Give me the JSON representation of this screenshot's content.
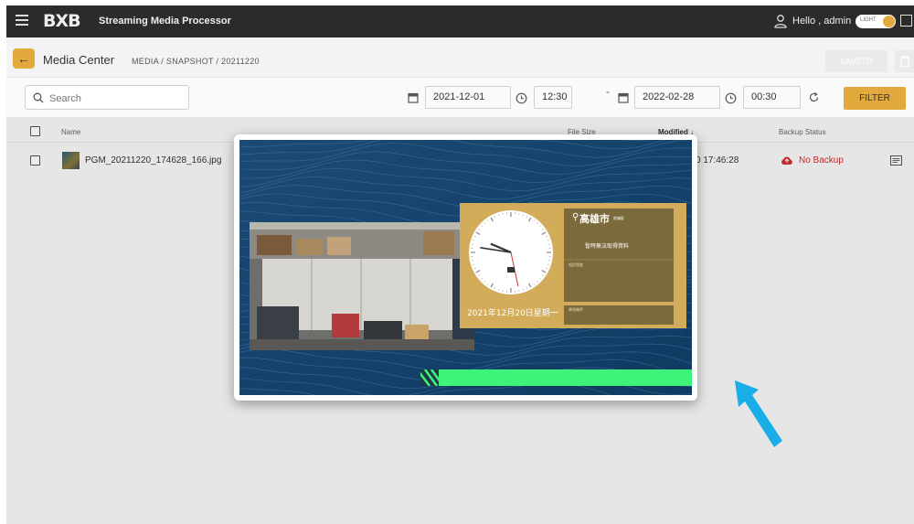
{
  "topbar": {
    "logo": "BXB",
    "app_title": "Streaming Media Processor",
    "greeting": "Hello , admin",
    "theme_toggle_label": "LIGHT"
  },
  "header": {
    "title": "Media Center",
    "breadcrumb": "MEDIA  /  SNAPSHOT  /  20211220",
    "saveto_label": "SAVETO"
  },
  "filters": {
    "search_placeholder": "Search",
    "start_date": "2021-12-01",
    "start_time": "12:30",
    "separator": "-",
    "end_date": "2022-02-28",
    "end_time": "00:30",
    "filter_label": "FILTER"
  },
  "table": {
    "columns": [
      "Name",
      "File Size",
      "Modified ↓",
      "Backup Status"
    ],
    "rows": [
      {
        "name": "PGM_20211220_174628_166.jpg",
        "modified": "0 17:46:28",
        "backup_status": "No Backup"
      }
    ]
  },
  "preview": {
    "city": "高雄市",
    "city_suffix": "前鎮區",
    "weather_msg": "暫時無法取得資料",
    "detail_label": "相對濕度 ",
    "extra_label": "降雨機率",
    "date_text": "2021年12月20日星期一",
    "clock_hour": 9,
    "clock_minute": 46,
    "clock_second": 28
  },
  "colors": {
    "accent": "#e2a93c",
    "topbar": "#2b2b2b",
    "no_backup": "#d32f2f",
    "preview_bg": "#16426b",
    "progress_green": "#3ef37a",
    "arrow": "#1aaee8"
  }
}
